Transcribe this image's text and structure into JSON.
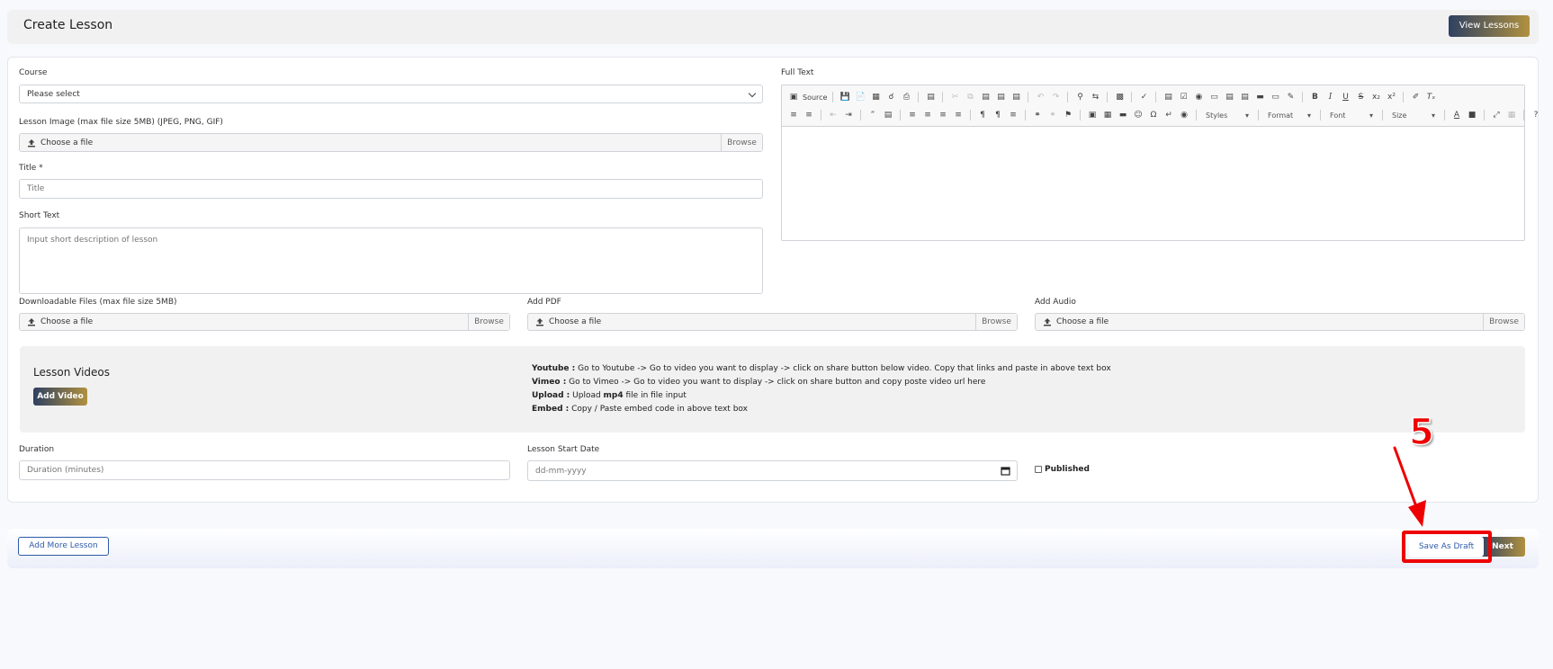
{
  "header": {
    "title": "Create Lesson",
    "view_lessons_label": "View Lessons"
  },
  "course": {
    "label": "Course",
    "selected": "Please select"
  },
  "lesson_image": {
    "label": "Lesson Image (max file size 5MB) (JPEG, PNG, GIF)",
    "choose": "Choose a file",
    "browse": "Browse"
  },
  "title_field": {
    "label": "Title *",
    "placeholder": "Title"
  },
  "short_text": {
    "label": "Short Text",
    "placeholder": "Input short description of lesson"
  },
  "full_text": {
    "label": "Full Text",
    "toolbar": {
      "source": "Source",
      "styles": "Styles",
      "format": "Format",
      "font": "Font",
      "size": "Size"
    }
  },
  "downloadable": {
    "label": "Downloadable Files (max file size 5MB)",
    "choose": "Choose a file",
    "browse": "Browse"
  },
  "pdf": {
    "label": "Add PDF",
    "choose": "Choose a file",
    "browse": "Browse"
  },
  "audio": {
    "label": "Add Audio",
    "choose": "Choose a file",
    "browse": "Browse"
  },
  "videos": {
    "title": "Lesson Videos",
    "add_label": "Add Video",
    "help": [
      {
        "key": "Youtube :",
        "text": " Go to Youtube -> Go to video you want to display -> click on share button below video. Copy that links and paste in above text box"
      },
      {
        "key": "Vimeo :",
        "text": " Go to Vimeo -> Go to video you want to display -> click on share button and copy poste video url here"
      },
      {
        "key": "Upload :",
        "text_pre": " Upload ",
        "bold": "mp4",
        "text_post": " file in file input"
      },
      {
        "key": "Embed :",
        "text": " Copy / Paste embed code in above text box"
      }
    ]
  },
  "duration": {
    "label": "Duration",
    "placeholder": "Duration (minutes)"
  },
  "start_date": {
    "label": "Lesson Start Date",
    "placeholder": "dd-mm-yyyy"
  },
  "published": {
    "label": "Published",
    "checked": false
  },
  "footer": {
    "add_more_label": "Add More Lesson",
    "save_draft_label": "Save As Draft",
    "next_label": "Next"
  },
  "annotation": {
    "step_number": "5",
    "color": "#ee0000"
  },
  "colors": {
    "gradient_start": "#2e4062",
    "gradient_end": "#b1913f",
    "accent_blue": "#2e5aa8"
  }
}
